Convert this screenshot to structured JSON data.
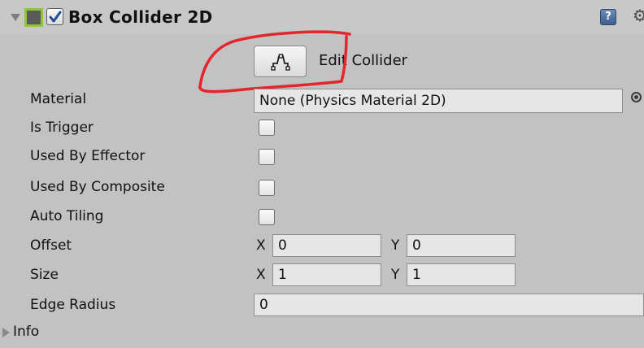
{
  "component": {
    "title": "Box Collider 2D",
    "enabled": true,
    "accent_color": "#8ec43f"
  },
  "edit_collider": {
    "label": "Edit Collider",
    "icon": "edit-collider-icon"
  },
  "annotation": {
    "color": "#e3262b"
  },
  "properties": {
    "material": {
      "label": "Material",
      "value": "None (Physics Material 2D)"
    },
    "is_trigger": {
      "label": "Is Trigger",
      "checked": false
    },
    "used_by_effector": {
      "label": "Used By Effector",
      "checked": false
    },
    "used_by_composite": {
      "label": "Used By Composite",
      "checked": false
    },
    "auto_tiling": {
      "label": "Auto Tiling",
      "checked": false
    },
    "offset": {
      "label": "Offset",
      "x_label": "X",
      "x": "0",
      "y_label": "Y",
      "y": "0"
    },
    "size": {
      "label": "Size",
      "x_label": "X",
      "x": "1",
      "y_label": "Y",
      "y": "1"
    },
    "edge_radius": {
      "label": "Edge Radius",
      "value": "0"
    }
  },
  "info": {
    "label": "Info"
  }
}
